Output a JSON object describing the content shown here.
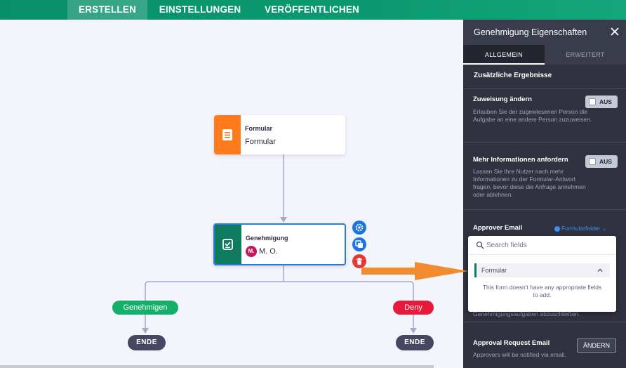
{
  "topbar": {
    "tabs": [
      {
        "label": "ERSTELLEN",
        "active": true
      },
      {
        "label": "EINSTELLUNGEN",
        "active": false
      },
      {
        "label": "VERÖFFENTLICHEN",
        "active": false
      }
    ]
  },
  "canvas": {
    "form_node": {
      "title": "Formular",
      "subtitle": "Formular",
      "icon": "form-document-icon",
      "color": "#ff7a1a"
    },
    "approval_node": {
      "title": "Genehmigung",
      "assignee_initials": "M.",
      "assignee_name": "M. O.",
      "icon": "approval-clipboard-icon",
      "color": "#0e7b60"
    },
    "node_actions": [
      "gear-icon",
      "duplicate-icon",
      "trash-icon"
    ],
    "branches": {
      "approve_label": "Genehmigen",
      "deny_label": "Deny"
    },
    "end_label": "ENDE"
  },
  "panel": {
    "title": "Genehmigung Eigenschaften",
    "tabs": [
      {
        "label": "ALLGEMEIN",
        "active": true
      },
      {
        "label": "ERWEITERT",
        "active": false
      }
    ],
    "section_title": "Zusätzliche Ergebnisse",
    "reassign": {
      "title": "Zuweisung ändern",
      "description": "Erlauben Sie der zugewiesenen Person die Aufgabe an eine andere Person zuzuweisen.",
      "toggle_label": "AUS"
    },
    "more_info": {
      "title": "Mehr Informationen anfordern",
      "description": "Lassen Sie Ihre Nutzer nach mehr Informationen zu der Formular-Antwort fragen, bevor diese die Anfrage annehmen oder ablehnen.",
      "toggle_label": "AUS"
    },
    "approver_email": {
      "title": "Approver Email",
      "link_label": "Formularfelder"
    },
    "hidden_text": "Genehmigungsaufgaben abzuschließen.",
    "request_email": {
      "title": "Approval Request Email",
      "description": "Approvers will be notified via email.",
      "button_label": "ÄNDERN"
    }
  },
  "dropdown": {
    "search_placeholder": "Search fields",
    "group_label": "Formular",
    "empty_message": "This form doesn't have any appropriate fields to add."
  },
  "colors": {
    "accent_green": "#0b9a6f",
    "panel_bg": "#30333f",
    "arrow_orange": "#f28a2e",
    "approve_green": "#13b06a",
    "deny_red": "#e8193b"
  }
}
